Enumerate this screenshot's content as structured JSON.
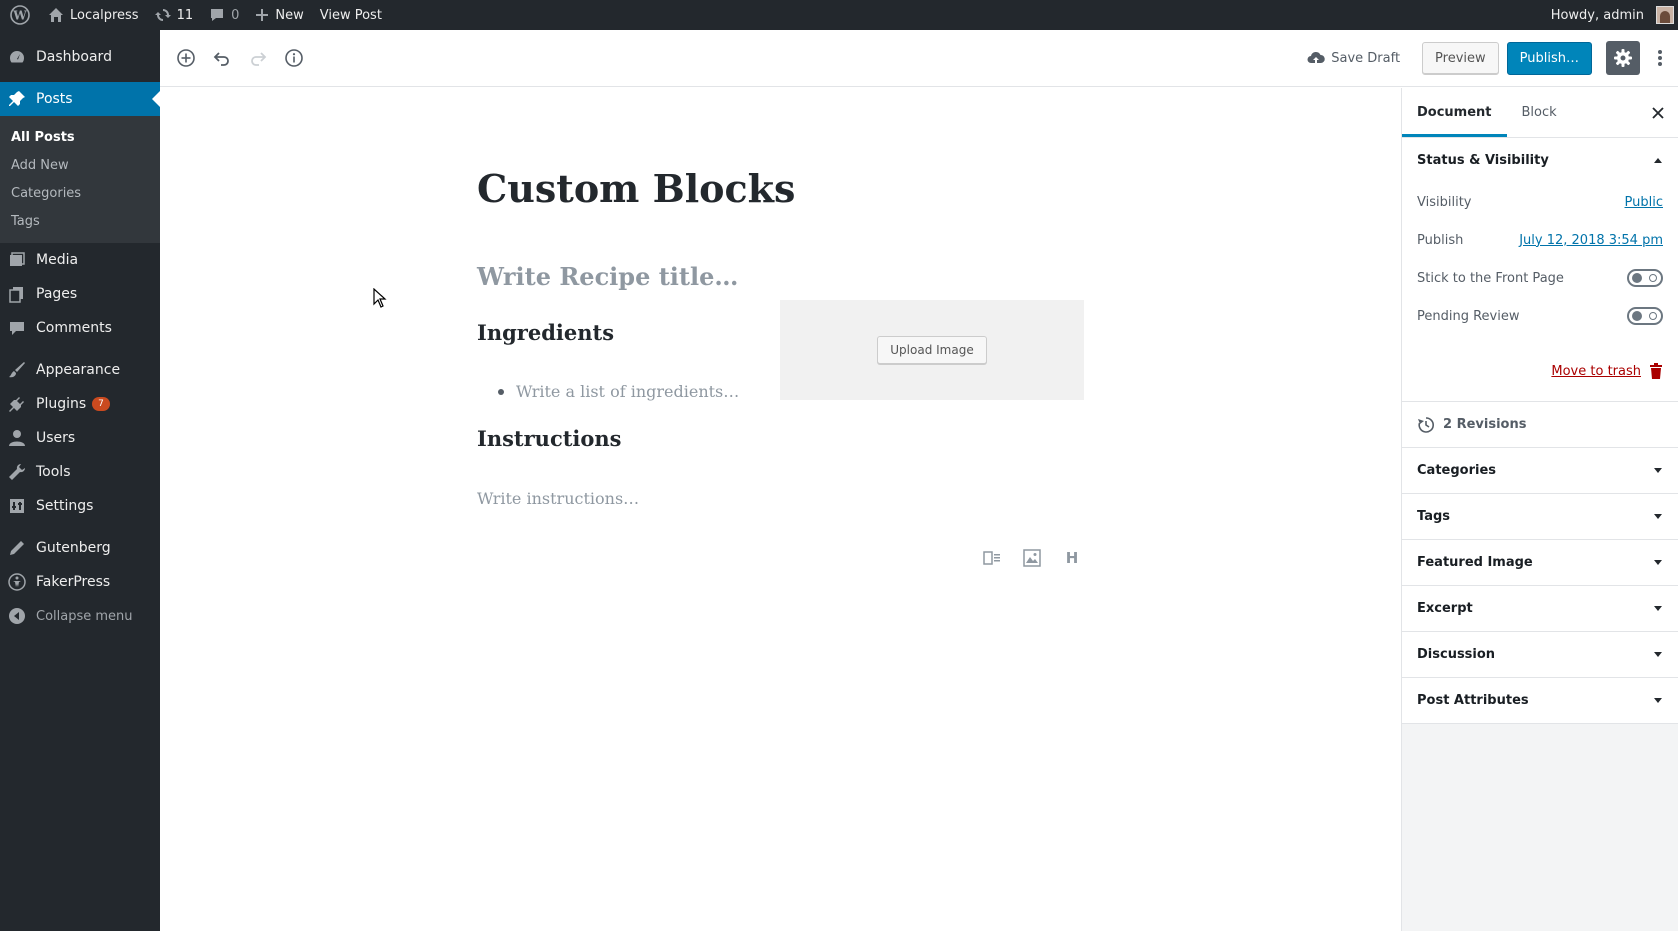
{
  "adminbar": {
    "site_name": "Localpress",
    "updates_count": "11",
    "comments_count": "0",
    "new_label": "New",
    "view_post_label": "View Post",
    "howdy": "Howdy, admin"
  },
  "menu": {
    "dashboard": "Dashboard",
    "posts": "Posts",
    "posts_submenu": [
      "All Posts",
      "Add New",
      "Categories",
      "Tags"
    ],
    "media": "Media",
    "pages": "Pages",
    "comments": "Comments",
    "appearance": "Appearance",
    "plugins": "Plugins",
    "plugins_badge": "7",
    "users": "Users",
    "tools": "Tools",
    "settings": "Settings",
    "gutenberg": "Gutenberg",
    "fakerpress": "FakerPress",
    "collapse": "Collapse menu"
  },
  "header": {
    "save_draft": "Save Draft",
    "preview": "Preview",
    "publish": "Publish…"
  },
  "content": {
    "post_title": "Custom Blocks",
    "recipe_title_placeholder": "Write Recipe title…",
    "ingredients_heading": "Ingredients",
    "ingredients_placeholder": "Write a list of ingredients…",
    "instructions_heading": "Instructions",
    "instructions_placeholder": "Write instructions…",
    "upload_image": "Upload Image",
    "inserter_heading_icon": "H"
  },
  "sidebar": {
    "tabs": [
      "Document",
      "Block"
    ],
    "status_visibility": {
      "title": "Status & Visibility",
      "visibility_label": "Visibility",
      "visibility_value": "Public",
      "publish_label": "Publish",
      "publish_value": "July 12, 2018 3:54 pm",
      "sticky_label": "Stick to the Front Page",
      "pending_label": "Pending Review",
      "trash_label": "Move to trash"
    },
    "revisions": "2 Revisions",
    "panels": [
      "Categories",
      "Tags",
      "Featured Image",
      "Excerpt",
      "Discussion",
      "Post Attributes"
    ]
  },
  "colors": {
    "admin_dark": "#23282d",
    "accent": "#0073aa",
    "publish_button": "#0085ba",
    "trash": "#a00",
    "badge": "#ca4a1f"
  }
}
